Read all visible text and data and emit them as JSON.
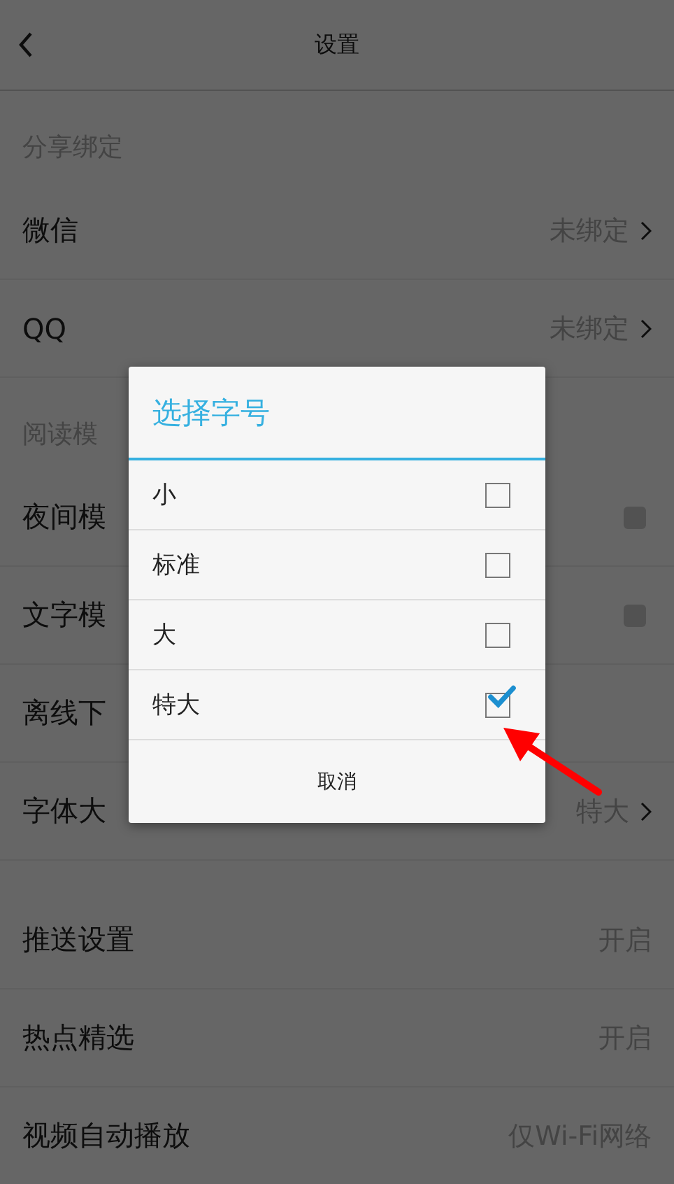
{
  "header": {
    "title": "设置"
  },
  "sections": [
    {
      "title": "分享绑定",
      "items": [
        {
          "kind": "link",
          "label": "微信",
          "value": "未绑定"
        },
        {
          "kind": "link",
          "label": "QQ",
          "value": "未绑定"
        }
      ]
    },
    {
      "title": "阅读模",
      "items": [
        {
          "kind": "toggle",
          "label": "夜间模",
          "checked": false
        },
        {
          "kind": "toggle",
          "label": "文字模",
          "checked": false
        },
        {
          "kind": "plain",
          "label": "离线下"
        },
        {
          "kind": "link",
          "label": "字体大",
          "value": "特大"
        }
      ]
    },
    {
      "items": [
        {
          "kind": "value",
          "label": "推送设置",
          "value": "开启"
        },
        {
          "kind": "value",
          "label": "热点精选",
          "value": "开启"
        },
        {
          "kind": "value",
          "label": "视频自动播放",
          "value": "仅Wi-Fi网络"
        }
      ]
    }
  ],
  "dialog": {
    "title": "选择字号",
    "options": [
      {
        "label": "小",
        "selected": false
      },
      {
        "label": "标准",
        "selected": false
      },
      {
        "label": "大",
        "selected": false
      },
      {
        "label": "特大",
        "selected": true
      }
    ],
    "cancel": "取消"
  }
}
